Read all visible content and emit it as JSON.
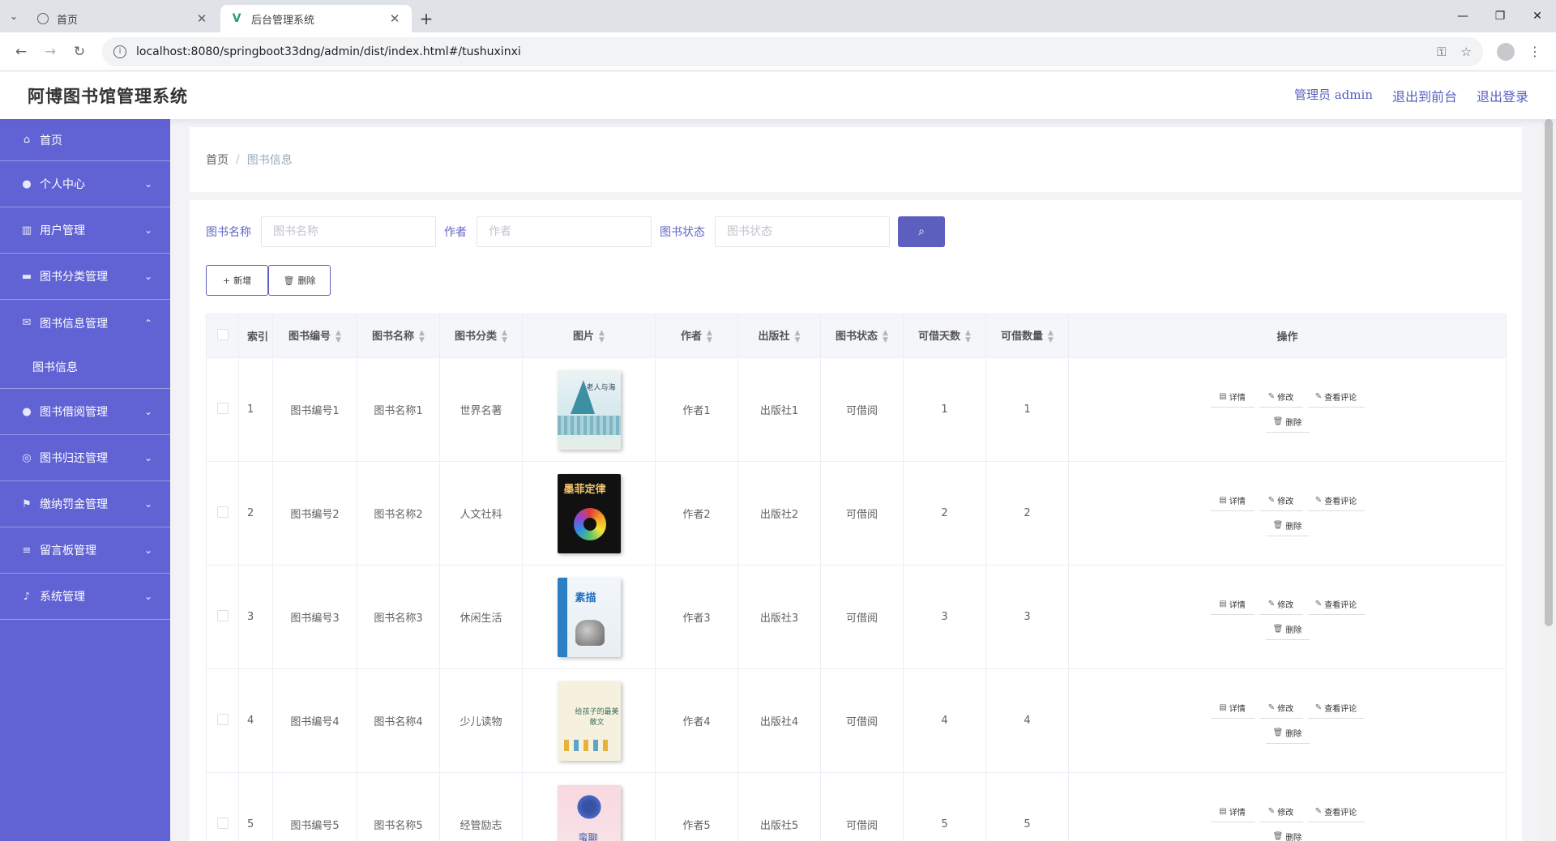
{
  "browser": {
    "tabs": [
      {
        "title": "首页",
        "active": false,
        "icon": "globe-icon"
      },
      {
        "title": "后台管理系统",
        "active": true,
        "icon": "vue-logo-icon"
      }
    ],
    "url": "localhost:8080/springboot33dng/admin/dist/index.html#/tushuxinxi"
  },
  "header": {
    "title": "阿博图书馆管理系统",
    "admin_label": "管理员 admin",
    "to_front": "退出到前台",
    "logout": "退出登录"
  },
  "sidebar": {
    "items": [
      {
        "label": "首页",
        "icon": "home-icon"
      },
      {
        "label": "个人中心",
        "icon": "user-icon"
      },
      {
        "label": "用户管理",
        "icon": "building-icon"
      },
      {
        "label": "图书分类管理",
        "icon": "briefcase-icon"
      },
      {
        "label": "图书信息管理",
        "icon": "mail-icon",
        "expanded": true,
        "sub": [
          "图书信息"
        ]
      },
      {
        "label": "图书借阅管理",
        "icon": "user-icon"
      },
      {
        "label": "图书归还管理",
        "icon": "circle-icon"
      },
      {
        "label": "缴纳罚金管理",
        "icon": "flag-icon"
      },
      {
        "label": "留言板管理",
        "icon": "list-icon"
      },
      {
        "label": "系统管理",
        "icon": "mic-icon"
      }
    ]
  },
  "breadcrumb": {
    "home": "首页",
    "sep": "/",
    "current": "图书信息"
  },
  "search": {
    "name_label": "图书名称",
    "name_placeholder": "图书名称",
    "author_label": "作者",
    "author_placeholder": "作者",
    "status_label": "图书状态",
    "status_placeholder": "图书状态",
    "search_icon": "search-icon"
  },
  "actions": {
    "add": "新增",
    "delete": "删除"
  },
  "table": {
    "headers": {
      "index": "索引",
      "code": "图书编号",
      "name": "图书名称",
      "category": "图书分类",
      "image": "图片",
      "author": "作者",
      "publisher": "出版社",
      "status": "图书状态",
      "days": "可借天数",
      "qty": "可借数量",
      "ops": "操作"
    },
    "rows": [
      {
        "index": "1",
        "code": "图书编号1",
        "name": "图书名称1",
        "category": "世界名著",
        "author": "作者1",
        "publisher": "出版社1",
        "status": "可借阅",
        "days": "1",
        "qty": "1",
        "cover_text": "老人与海"
      },
      {
        "index": "2",
        "code": "图书编号2",
        "name": "图书名称2",
        "category": "人文社科",
        "author": "作者2",
        "publisher": "出版社2",
        "status": "可借阅",
        "days": "2",
        "qty": "2",
        "cover_text": "墨菲定律"
      },
      {
        "index": "3",
        "code": "图书编号3",
        "name": "图书名称3",
        "category": "休闲生活",
        "author": "作者3",
        "publisher": "出版社3",
        "status": "可借阅",
        "days": "3",
        "qty": "3",
        "cover_text": "素描"
      },
      {
        "index": "4",
        "code": "图书编号4",
        "name": "图书名称4",
        "category": "少儿读物",
        "author": "作者4",
        "publisher": "出版社4",
        "status": "可借阅",
        "days": "4",
        "qty": "4",
        "cover_text": "给孩子的最美散文"
      },
      {
        "index": "5",
        "code": "图书编号5",
        "name": "图书名称5",
        "category": "经管励志",
        "author": "作者5",
        "publisher": "出版社5",
        "status": "可借阅",
        "days": "5",
        "qty": "5",
        "cover_text": "蛮聊"
      }
    ],
    "row_ops": {
      "detail": "详情",
      "edit": "修改",
      "comments": "查看评论",
      "delete": "删除"
    }
  },
  "colors": {
    "sidebar": "#6163d4",
    "accent": "#5c5fbd",
    "header_link": "#5a5fc0"
  }
}
